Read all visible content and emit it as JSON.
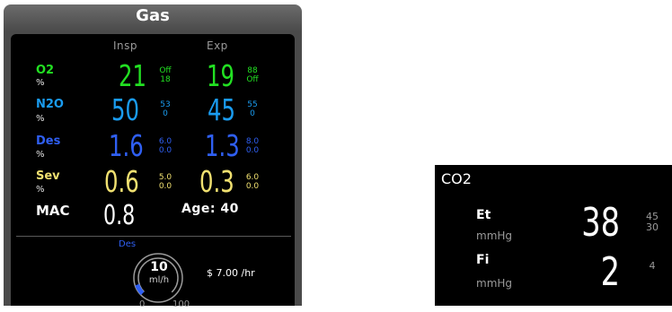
{
  "gas": {
    "title": "Gas",
    "columns": {
      "insp": "Insp",
      "exp": "Exp"
    },
    "agents": [
      {
        "name": "O2",
        "unit": "%",
        "insp": "21",
        "insp_hi": "Off",
        "insp_lo": "18",
        "exp": "19",
        "exp_hi": "88",
        "exp_lo": "Off",
        "color": "#22e022"
      },
      {
        "name": "N2O",
        "unit": "%",
        "insp": "50",
        "insp_hi": "53",
        "insp_lo": "0",
        "exp": "45",
        "exp_hi": "55",
        "exp_lo": "0",
        "color": "#1a9cf0"
      },
      {
        "name": "Des",
        "unit": "%",
        "insp": "1.6",
        "insp_hi": "6.0",
        "insp_lo": "0.0",
        "exp": "1.3",
        "exp_hi": "8.0",
        "exp_lo": "0.0",
        "color": "#2f5ff2"
      },
      {
        "name": "Sev",
        "unit": "%",
        "insp": "0.6",
        "insp_hi": "5.0",
        "insp_lo": "0.0",
        "exp": "0.3",
        "exp_hi": "6.0",
        "exp_lo": "0.0",
        "color": "#f0e070"
      }
    ],
    "mac": {
      "name": "MAC",
      "value": "0.8"
    },
    "age": "Age: 40",
    "consumption": {
      "agent": "Des",
      "value": "10",
      "unit": "ml/h",
      "min": "0",
      "max": "100",
      "fraction": 0.1,
      "cost": "$ 7.00 /hr"
    }
  },
  "co2": {
    "title": "CO2",
    "rows": [
      {
        "name": "Et",
        "unit": "mmHg",
        "value": "38",
        "hi": "45",
        "lo": "30"
      },
      {
        "name": "Fi",
        "unit": "mmHg",
        "value": "2",
        "hi": "4"
      }
    ]
  }
}
